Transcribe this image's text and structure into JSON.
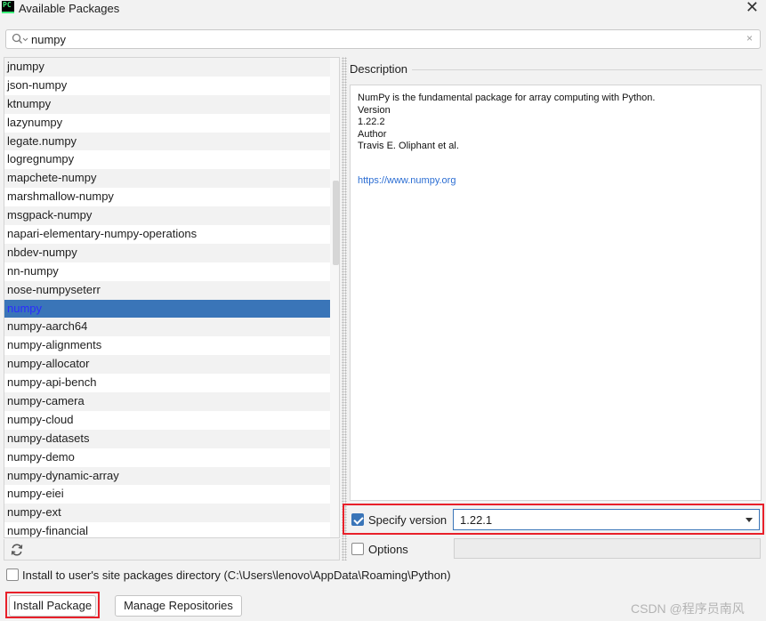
{
  "window": {
    "title": "Available Packages",
    "close_glyph": "✕",
    "icon_text": "PC"
  },
  "search": {
    "value": "numpy",
    "clear_glyph": "×"
  },
  "packages": [
    "jnumpy",
    "json-numpy",
    "ktnumpy",
    "lazynumpy",
    "legate.numpy",
    "logregnumpy",
    "mapchete-numpy",
    "marshmallow-numpy",
    "msgpack-numpy",
    "napari-elementary-numpy-operations",
    "nbdev-numpy",
    "nn-numpy",
    "nose-numpyseterr",
    "numpy",
    "numpy-aarch64",
    "numpy-alignments",
    "numpy-allocator",
    "numpy-api-bench",
    "numpy-camera",
    "numpy-cloud",
    "numpy-datasets",
    "numpy-demo",
    "numpy-dynamic-array",
    "numpy-eiei",
    "numpy-ext",
    "numpy-financial"
  ],
  "selected_package": "numpy",
  "description": {
    "label": "Description",
    "summary": "NumPy is the fundamental package for array computing with Python.",
    "version_label": "Version",
    "version": "1.22.2",
    "author_label": "Author",
    "author": "Travis E. Oliphant et al.",
    "url": "https://www.numpy.org"
  },
  "specify_version": {
    "label": "Specify version",
    "checked": true,
    "value": "1.22.1"
  },
  "options": {
    "label": "Options",
    "checked": false,
    "value": ""
  },
  "install_site": {
    "label": "Install to user's site packages directory (C:\\Users\\lenovo\\AppData\\Roaming\\Python)",
    "checked": false
  },
  "buttons": {
    "install": "Install Package",
    "manage": "Manage Repositories"
  },
  "watermark": "CSDN @程序员南风",
  "colors": {
    "selection": "#3a75b8",
    "highlight_box": "#e8202a",
    "link": "#2c6ed3"
  }
}
